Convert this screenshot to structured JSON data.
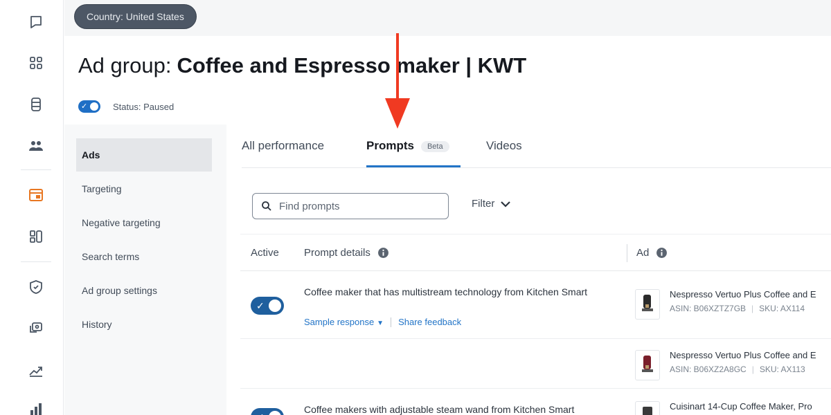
{
  "rail": {
    "icons": [
      "comment-icon",
      "grid-icon",
      "database-icon",
      "people-icon",
      "campaign-icon",
      "layout-icon",
      "shield-icon",
      "chat-icon",
      "trend-icon",
      "bar-chart-icon"
    ],
    "accent_color": "#e87722"
  },
  "topbar": {
    "country_label": "Country: United States"
  },
  "header": {
    "title_prefix": "Ad group:",
    "title_name": "Coffee and Espresso maker | KWT",
    "status_text": "Status: Paused"
  },
  "subnav": {
    "items": [
      {
        "label": "Ads"
      },
      {
        "label": "Targeting"
      },
      {
        "label": "Negative targeting"
      },
      {
        "label": "Search terms"
      },
      {
        "label": "Ad group settings"
      },
      {
        "label": "History"
      }
    ]
  },
  "tabs": {
    "all_performance": "All performance",
    "prompts": "Prompts",
    "beta": "Beta",
    "videos": "Videos"
  },
  "search": {
    "placeholder": "Find prompts",
    "value": ""
  },
  "filter_label": "Filter",
  "table": {
    "headers": {
      "active": "Active",
      "prompt_details": "Prompt details",
      "ad": "Ad"
    },
    "rows": [
      {
        "active": true,
        "prompt": "Coffee maker that has multistream technology from Kitchen Smart",
        "sample_response": "Sample response",
        "share_feedback": "Share feedback",
        "ad_title": "Nespresso Vertuo Plus Coffee and E",
        "asin": "ASIN: B06XZTZ7GB",
        "sku": "SKU: AX114"
      },
      {
        "ad_title": "Nespresso Vertuo Plus Coffee and E",
        "asin": "ASIN: B06XZ2A8GC",
        "sku": "SKU: AX113"
      },
      {
        "active": true,
        "prompt": "Coffee makers with adjustable steam wand from Kitchen Smart",
        "ad_title": "Cuisinart 14-Cup Coffee Maker, Pro"
      }
    ]
  },
  "colors": {
    "primary": "#2274c7",
    "toggle": "#1f5f9e",
    "arrow": "#f03a22",
    "pill": "#4d5765"
  }
}
